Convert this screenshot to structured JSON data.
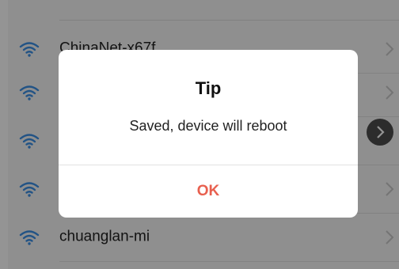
{
  "wifi_list": {
    "networks": [
      {
        "ssid": "ChinaNet-x67f"
      },
      {
        "ssid": ""
      },
      {
        "ssid": ""
      },
      {
        "ssid": ""
      },
      {
        "ssid": "chuanglan-mi"
      }
    ]
  },
  "dialog": {
    "title": "Tip",
    "message": "Saved, device will reboot",
    "ok_label": "OK"
  },
  "colors": {
    "wifi_icon": "#3b8fe6",
    "ok_text": "#e8604f",
    "overlay": "rgba(0,0,0,0.42)"
  },
  "icons": {
    "wifi": "wifi-icon",
    "chevron": "chevron-right-icon",
    "circle_arrow": "circle-arrow-right-icon"
  }
}
